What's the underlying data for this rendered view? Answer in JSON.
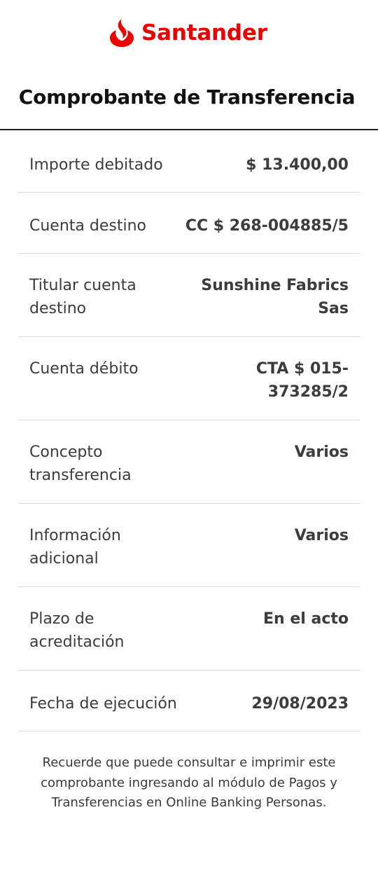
{
  "brand": {
    "name": "Santander",
    "color": "#ec0000",
    "icon": "santander-flame-icon"
  },
  "title": "Comprobante de Transferencia",
  "rows": [
    {
      "label": "Importe debitado",
      "value": "$ 13.400,00"
    },
    {
      "label": "Cuenta destino",
      "value": "CC $ 268-004885/5"
    },
    {
      "label": "Titular cuenta destino",
      "value": "Sunshine Fabrics Sas"
    },
    {
      "label": "Cuenta débito",
      "value": "CTA $ 015-373285/2"
    },
    {
      "label": "Concepto transferencia",
      "value": "Varios"
    },
    {
      "label": "Información adicional",
      "value": "Varios"
    },
    {
      "label": "Plazo de acreditación",
      "value": "En el acto"
    },
    {
      "label": "Fecha de ejecución",
      "value": "29/08/2023"
    }
  ],
  "note": "Recuerde que puede consultar e imprimir este comprobante ingresando al módulo de Pagos y Transferencias en Online Banking Personas."
}
